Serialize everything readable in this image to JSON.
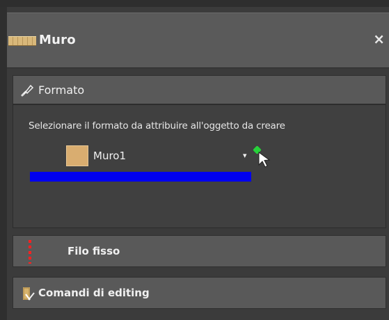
{
  "header": {
    "title": "Muro",
    "close_label": "×",
    "icon": "wall-icon"
  },
  "formato": {
    "label": "Formato",
    "icon": "brush-icon",
    "instruction": "Selezionare il formato da attribuire all'oggetto da creare",
    "selected_format": "Muro1",
    "swatch_color": "#d9ad70",
    "dropdown_arrow": "▾",
    "highlight_color": "#0000ef"
  },
  "filo_fisso": {
    "label": "Filo fisso",
    "icon": "dashed-line-icon"
  },
  "comandi": {
    "label": "Comandi di editing",
    "icon": "edit-tools-icon"
  }
}
